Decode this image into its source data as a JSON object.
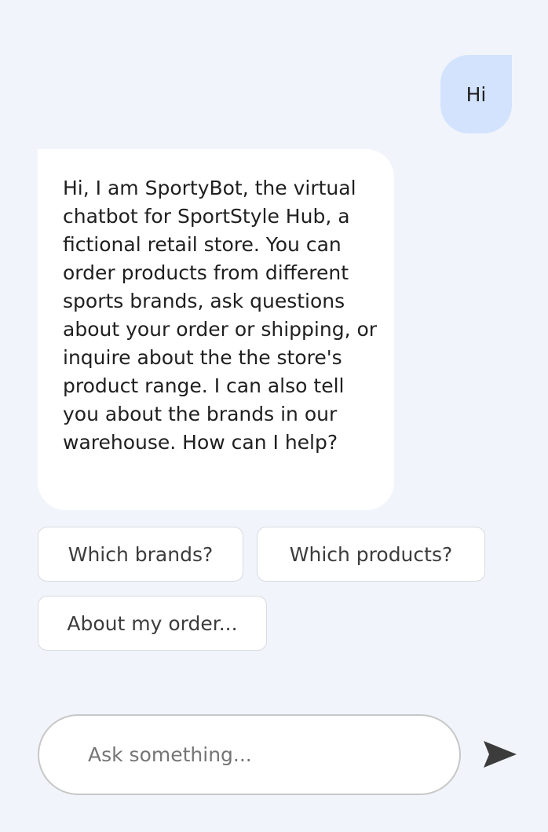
{
  "conversation": {
    "user_message": "Hi",
    "bot_message": "Hi, I am SportyBot, the virtual chatbot for SportStyle Hub, a fictional retail store. You can order products from different sports brands, ask questions about your order or shipping, or inquire about the the store's product range. I can also tell you about the brands in our warehouse. How can I help?"
  },
  "suggestions": {
    "brands": "Which brands?",
    "products": "Which products?",
    "order": "About my order..."
  },
  "composer": {
    "placeholder": "Ask something...",
    "value": "",
    "send_icon": "send-icon"
  },
  "colors": {
    "background": "#f1f5fb",
    "user_bubble": "#d3e3fd",
    "bot_bubble": "#ffffff",
    "send_icon": "#3c3c3c"
  }
}
